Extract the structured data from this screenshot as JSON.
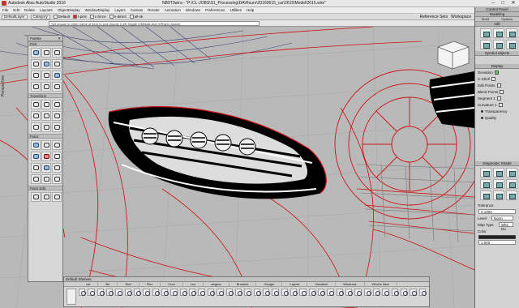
{
  "window": {
    "app_title": "Autodesk Alias AutoStudio 2016",
    "doc_title": "NB9T3wira - \"P:\\CL-JOBS\\S1_Processing\\DA\\Hours\\20160615_car\\2615\\Model\\2615.wire\"",
    "minimize": "–",
    "maximize": "□",
    "close": "✕"
  },
  "menubar": [
    "File",
    "Edit",
    "Delete",
    "Layouts",
    "ObjectDisplay",
    "WindowDisplay",
    "Layers",
    "Canvas",
    "Render",
    "Animation",
    "Windows",
    "Preferences",
    "Utilities",
    "Help"
  ],
  "shelfbar": {
    "layer_select": "DefaultLayer",
    "category_label": "Category",
    "chips": [
      {
        "label": "Default",
        "color": "#ffffff"
      },
      {
        "label": "t-pick",
        "color": "#dd2222"
      },
      {
        "label": "c-force",
        "color": "#ffffff"
      },
      {
        "label": "n-direct",
        "color": "#ffffff"
      },
      {
        "label": "all-ok",
        "color": "#ffffff"
      }
    ],
    "right_items": [
      "Reference Sets",
      "Workspace"
    ]
  },
  "statusbar": {
    "prompt": "Set mouse to enter name of item to pick (input): [Left Toggle X/Middle Add X/Right Unpick]"
  },
  "viewport": {
    "label": "Perspective"
  },
  "palette": {
    "title": "Palette",
    "sections": [
      {
        "name": "Pick",
        "count": 12
      },
      {
        "name": "Transform",
        "count": 12
      },
      {
        "name": "Paint",
        "count": 15
      },
      {
        "name": "Paint Edit",
        "count": 3
      }
    ]
  },
  "shelves": {
    "title": "Default Shelves",
    "tabs": [
      "cut",
      "file",
      "Surf",
      "Flex",
      "Curv",
      "Loc",
      "degree",
      "Brushes",
      "Google",
      "Layout",
      "Visualize",
      "Windows",
      "What's New"
    ],
    "icon_count": 38
  },
  "rightpanel": {
    "header": "Control Panel",
    "mode": "Modeling",
    "subtabs": [
      "Shelf",
      "Options"
    ],
    "section_edit": "edit",
    "section_symbols": "Symbol objects",
    "display_title": "Display",
    "display_rows": [
      {
        "label": "Deviation",
        "on": true
      },
      {
        "label": "C-Shell",
        "on": false
      },
      {
        "label": "Edit Points",
        "on": false
      },
      {
        "label": "Blend Points",
        "on": false
      },
      {
        "label": "Segment 1",
        "on": false
      },
      {
        "label": "Curvature 1",
        "on": false
      }
    ],
    "radio_rows": [
      "Transparency",
      "Quality"
    ],
    "diagnostic_title": "Diagnostic Shade",
    "tolerance_label": "Tolerance",
    "tolerance_value": "0.1000",
    "level_label": "Level",
    "level_value": "Norm",
    "map_type_label": "Map Type",
    "map_type_value": "Whit Iso",
    "color_label": "Color",
    "color_value": "1.000",
    "colors": {
      "accent": "#6c6",
      "panel": "#d2d2d2"
    }
  }
}
